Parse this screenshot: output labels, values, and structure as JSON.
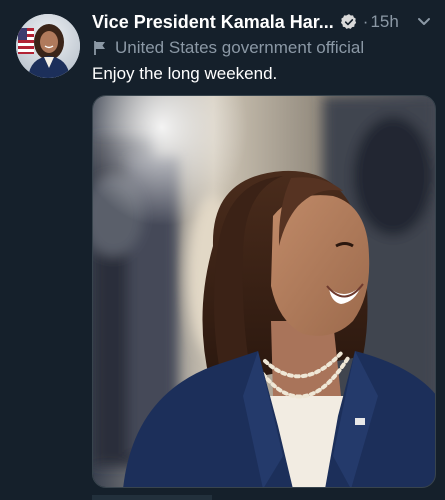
{
  "tweet": {
    "author_name": "Vice President Kamala Har...",
    "timestamp": "15h",
    "separator": "·",
    "label": "United States government official",
    "text": "Enjoy the long weekend."
  },
  "icons": {
    "verified": "verified-badge-icon",
    "label": "flag-icon",
    "more": "more-chevron-icon"
  },
  "colors": {
    "background": "#15202b",
    "secondary_text": "#8b98a5",
    "primary_text": "#ffffff",
    "navy_blazer": "#1c2f5a"
  }
}
